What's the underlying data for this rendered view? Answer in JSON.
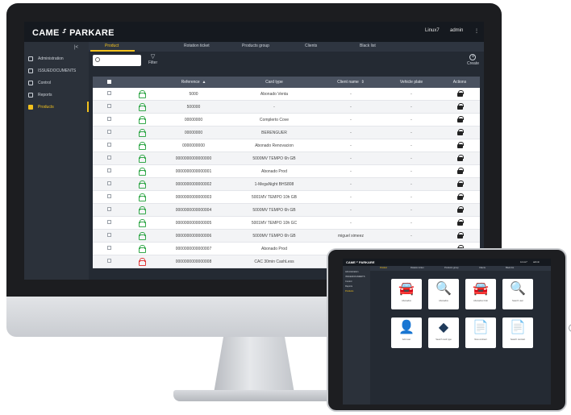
{
  "app": {
    "logo": "CAME ⸉ PARKARE",
    "version": "Linux7",
    "user": "admin",
    "kebab": "⋮",
    "collapse": "|<"
  },
  "sidebar": {
    "items": [
      {
        "label": "Administration",
        "active": false
      },
      {
        "label": "ISSUEDOCUMENTS",
        "active": false
      },
      {
        "label": "Control",
        "active": false
      },
      {
        "label": "Reports",
        "active": false
      },
      {
        "label": "Products",
        "active": true
      }
    ]
  },
  "tabs": [
    {
      "label": "Product",
      "active": true
    },
    {
      "label": "Rotation ticket",
      "active": false
    },
    {
      "label": "Products group",
      "active": false
    },
    {
      "label": "Clients",
      "active": false
    },
    {
      "label": "Black list",
      "active": false
    }
  ],
  "toolbar": {
    "search_placeholder": "",
    "filter_label": "Filter",
    "create_label": "Create"
  },
  "table": {
    "headers": {
      "reference": "Reference",
      "card_type": "Card type",
      "client_name": "Client name",
      "vehicle_plate": "Vehicle plate",
      "actions": "Actions",
      "sort_reference": "▲",
      "sort_client": "⇕"
    },
    "rows": [
      {
        "lock": "green",
        "reference": "5000",
        "card_type": "Abonado Venta",
        "client": "-",
        "plate": "-"
      },
      {
        "lock": "green",
        "reference": "500000",
        "card_type": "-",
        "client": "-",
        "plate": "-"
      },
      {
        "lock": "green",
        "reference": "00000000",
        "card_type": "Complerto Cove",
        "client": "-",
        "plate": "-"
      },
      {
        "lock": "green",
        "reference": "00000000",
        "card_type": "BERENGUER",
        "client": "-",
        "plate": "-"
      },
      {
        "lock": "green",
        "reference": "0000000000",
        "card_type": "Abonado Renovacion",
        "client": "-",
        "plate": "-"
      },
      {
        "lock": "green",
        "reference": "0000000000000000",
        "card_type": "5000MV TEMPO 6h GB",
        "client": "-",
        "plate": "-"
      },
      {
        "lock": "green",
        "reference": "0000000000000001",
        "card_type": "Abonado Prod",
        "client": "-",
        "plate": "-"
      },
      {
        "lock": "green",
        "reference": "0000000000000002",
        "card_type": "1-MegaNight BHS808",
        "client": "-",
        "plate": "-"
      },
      {
        "lock": "green",
        "reference": "0000000000000003",
        "card_type": "5001MV TEMPO 10h GB",
        "client": "-",
        "plate": "-"
      },
      {
        "lock": "green",
        "reference": "0000000000000004",
        "card_type": "5000MV TEMPO 6h GB",
        "client": "-",
        "plate": "-"
      },
      {
        "lock": "green",
        "reference": "0000000000000005",
        "card_type": "5001MV TEMPO 10h GC",
        "client": "-",
        "plate": "-"
      },
      {
        "lock": "green",
        "reference": "0000000000000006",
        "card_type": "5000MV TEMPO 6h GB",
        "client": "miguel ximeez",
        "plate": "-"
      },
      {
        "lock": "green",
        "reference": "0000000000000007",
        "card_type": "Abonado Prod",
        "client": "-",
        "plate": "-"
      },
      {
        "lock": "red",
        "reference": "0000000000000008",
        "card_type": "CAC 30min CashLess",
        "client": "-",
        "plate": "-"
      }
    ]
  },
  "tablet": {
    "logo": "CAME ⸉ PARKARE",
    "user_left": "Linux7",
    "user_right": "admin",
    "side_items": [
      "Administration",
      "ISSUEDOCUMENTS",
      "Control",
      "Reports",
      "Products"
    ],
    "tabs": [
      "Product",
      "Rotation ticket",
      "Products group",
      "Clients",
      "Black list"
    ],
    "cards": [
      {
        "icon": "car-plus-icon",
        "glyph": "🚘",
        "label": "Abonados"
      },
      {
        "icon": "search-icon",
        "glyph": "🔍",
        "label": "Abonados"
      },
      {
        "icon": "car-plus-icon",
        "glyph": "🚘",
        "label": "Abonados Club"
      },
      {
        "icon": "user-search-icon",
        "glyph": "🔍",
        "label": "Search user"
      },
      {
        "icon": "user-plus-icon",
        "glyph": "👤",
        "label": "Add user"
      },
      {
        "icon": "card-icon",
        "glyph": "◆",
        "label": "Search card type"
      },
      {
        "icon": "doc-plus-icon",
        "glyph": "📄",
        "label": "New contract"
      },
      {
        "icon": "doc-search-icon",
        "glyph": "📄",
        "label": "Search contract"
      }
    ]
  },
  "colors": {
    "accent": "#f2c11d",
    "lock_ok": "#33a84a",
    "lock_bad": "#e23b3b"
  }
}
